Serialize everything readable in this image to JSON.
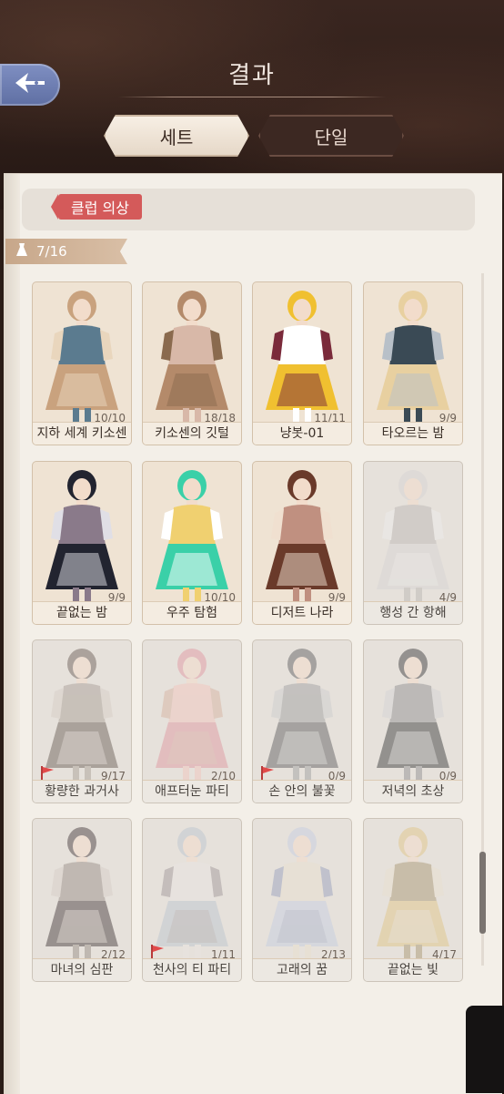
{
  "header": {
    "title": "결과",
    "tabs": [
      {
        "label": "세트",
        "active": true
      },
      {
        "label": "단일",
        "active": false
      }
    ]
  },
  "club_tag": "클럽 의상",
  "collection_count": "7/16",
  "colors": {
    "accent_red": "#d45a5a",
    "back_button": "#6f7fb3",
    "page_bg": "#f3efe8"
  },
  "cards": [
    {
      "name": "지하 세계 키소센",
      "progress": "10/10",
      "dim": false,
      "flag": false,
      "palette": [
        "#c9a27e",
        "#5b7b8f",
        "#e9d6bd"
      ]
    },
    {
      "name": "키소센의 깃털",
      "progress": "18/18",
      "dim": false,
      "flag": false,
      "palette": [
        "#b48a6a",
        "#d8b8a8",
        "#8a6a4e"
      ]
    },
    {
      "name": "냥봇-01",
      "progress": "11/11",
      "dim": false,
      "flag": false,
      "palette": [
        "#f0c030",
        "#ffffff",
        "#7a2a3a"
      ]
    },
    {
      "name": "타오르는 밤",
      "progress": "9/9",
      "dim": false,
      "flag": false,
      "palette": [
        "#e8d0a0",
        "#3a4a55",
        "#b8c0c8"
      ]
    },
    {
      "name": "끝없는 밤",
      "progress": "9/9",
      "dim": false,
      "flag": false,
      "palette": [
        "#222430",
        "#8a7a8a",
        "#e0dfe6"
      ]
    },
    {
      "name": "우주 탐험",
      "progress": "10/10",
      "dim": false,
      "flag": false,
      "palette": [
        "#3ad0a8",
        "#f0d070",
        "#ffffff"
      ]
    },
    {
      "name": "디저트 나라",
      "progress": "9/9",
      "dim": false,
      "flag": false,
      "palette": [
        "#6a3a2a",
        "#c09080",
        "#f0e0d0"
      ]
    },
    {
      "name": "행성 간 항해",
      "progress": "4/9",
      "dim": true,
      "flag": false,
      "palette": [
        "#d8d6d4",
        "#bfbcb8",
        "#ecebe9"
      ]
    },
    {
      "name": "황량한 과거사",
      "progress": "9/17",
      "dim": true,
      "flag": true,
      "palette": [
        "#7a6f68",
        "#b0a79f",
        "#d8d0c8"
      ]
    },
    {
      "name": "애프터눈 파티",
      "progress": "2/10",
      "dim": true,
      "flag": false,
      "palette": [
        "#e0a0a8",
        "#f0c8c0",
        "#d8b8a8"
      ]
    },
    {
      "name": "손 안의 불꽃",
      "progress": "0/9",
      "dim": true,
      "flag": true,
      "palette": [
        "#707070",
        "#a8a8a8",
        "#d0d0d0"
      ]
    },
    {
      "name": "저녁의 초상",
      "progress": "0/9",
      "dim": true,
      "flag": false,
      "palette": [
        "#505050",
        "#9a9a9a",
        "#d6d6d6"
      ]
    },
    {
      "name": "마녀의 심판",
      "progress": "2/12",
      "dim": true,
      "flag": false,
      "palette": [
        "#5a5050",
        "#a09890",
        "#d8d0c8"
      ]
    },
    {
      "name": "천사의 티 파티",
      "progress": "1/11",
      "dim": true,
      "flag": true,
      "palette": [
        "#c0c8d0",
        "#e8e4e0",
        "#a8a0a0"
      ]
    },
    {
      "name": "고래의 꿈",
      "progress": "2/13",
      "dim": true,
      "flag": false,
      "palette": [
        "#c8d0e0",
        "#e8e0d0",
        "#a0a8c0"
      ]
    },
    {
      "name": "끝없는 빛",
      "progress": "4/17",
      "dim": true,
      "flag": false,
      "palette": [
        "#e0c890",
        "#b0a080",
        "#e8e0d0"
      ]
    }
  ]
}
